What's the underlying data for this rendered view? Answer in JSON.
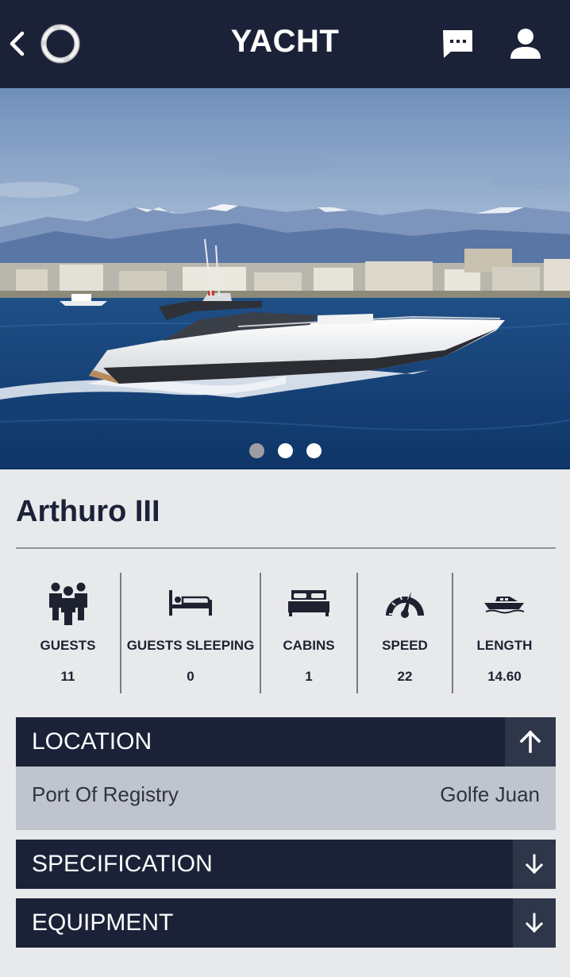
{
  "header": {
    "title": "YACHT",
    "back_icon": "chevron-left-icon",
    "logo_icon": "ring-logo",
    "chat_icon": "chat-bubble-icon",
    "user_icon": "user-icon"
  },
  "gallery": {
    "image": "yacht-photo",
    "slides": 3,
    "active_slide": 1
  },
  "yacht": {
    "name": "Arthuro III"
  },
  "stats": [
    {
      "icon": "guests-icon",
      "label": "GUESTS",
      "value": "11"
    },
    {
      "icon": "bed-icon",
      "label": "GUESTS SLEEPING",
      "value": "0"
    },
    {
      "icon": "double-bed-icon",
      "label": "CABINS",
      "value": "1"
    },
    {
      "icon": "speedometer-icon",
      "label": "SPEED",
      "value": "22"
    },
    {
      "icon": "boat-icon",
      "label": "LENGTH",
      "value": "14.60"
    }
  ],
  "sections": {
    "location": {
      "title": "LOCATION",
      "expanded": true,
      "toggle_icon": "arrow-up-icon",
      "rows": [
        {
          "key": "Port Of Registry",
          "value": "Golfe Juan"
        }
      ]
    },
    "specification": {
      "title": "SPECIFICATION",
      "expanded": false,
      "toggle_icon": "arrow-down-icon"
    },
    "equipment": {
      "title": "EQUIPMENT",
      "expanded": false,
      "toggle_icon": "arrow-down-icon"
    }
  },
  "colors": {
    "navy": "#1b2238",
    "toggle_bg": "#2e3649",
    "page_bg": "#e8e9eb",
    "row_bg": "#bfc4cd"
  }
}
